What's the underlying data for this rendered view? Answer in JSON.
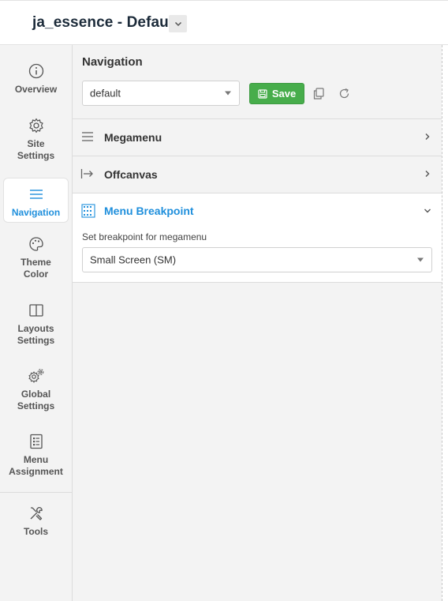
{
  "header": {
    "title": "ja_essence - Default",
    "dropdown_icon": "chevron-down-icon"
  },
  "sidebar": {
    "items": [
      {
        "label": "Overview",
        "icon": "info-icon",
        "active": false
      },
      {
        "label": "Site Settings",
        "icon": "gear-icon",
        "active": false
      },
      {
        "label": "Navigation",
        "icon": "menu-lines-icon",
        "active": true
      },
      {
        "label": "Theme Color",
        "icon": "palette-icon",
        "active": false
      },
      {
        "label": "Layouts Settings",
        "icon": "columns-icon",
        "active": false
      },
      {
        "label": "Global Settings",
        "icon": "gears-icon",
        "active": false
      },
      {
        "label": "Menu Assignment",
        "icon": "list-check-icon",
        "active": false
      },
      {
        "label": "Tools",
        "icon": "tools-icon",
        "active": false
      }
    ]
  },
  "main": {
    "title": "Navigation",
    "preset_select": {
      "value": "default"
    },
    "save_label": "Save",
    "panels": [
      {
        "title": "Megamenu",
        "icon": "hamburger-icon",
        "expanded": false
      },
      {
        "title": "Offcanvas",
        "icon": "arrow-bar-right-icon",
        "expanded": false
      },
      {
        "title": "Menu Breakpoint",
        "icon": "breakpoint-grid-icon",
        "expanded": true
      }
    ],
    "breakpoint": {
      "label": "Set breakpoint for megamenu",
      "value": "Small Screen (SM)"
    }
  },
  "colors": {
    "accent": "#1f8fdc",
    "save_green": "#47ad4b",
    "sidebar_bg": "#f3f3f3"
  }
}
